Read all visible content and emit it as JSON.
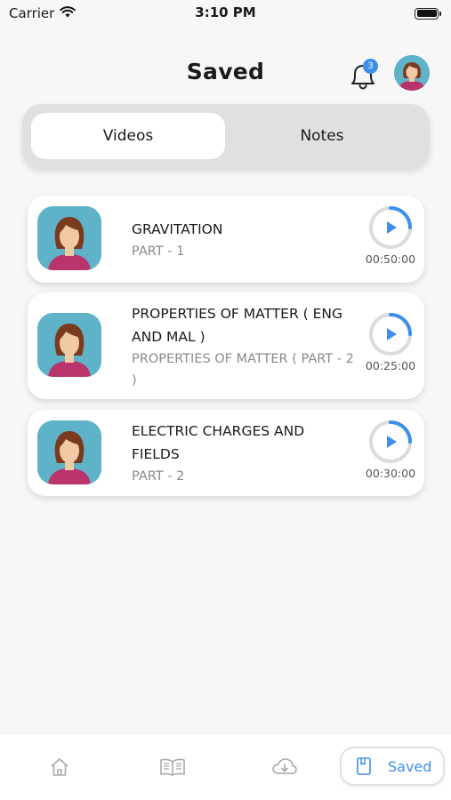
{
  "status_bar": {
    "carrier": "Carrier",
    "time": "3:10 PM"
  },
  "header": {
    "title": "Saved",
    "notification_count": "3"
  },
  "tabs": [
    {
      "label": "Videos",
      "active": true
    },
    {
      "label": "Notes",
      "active": false
    }
  ],
  "videos": [
    {
      "title": "GRAVITATION",
      "subtitle": "PART - 1",
      "duration": "00:50:00"
    },
    {
      "title": "PROPERTIES OF MATTER ( ENG AND MAL )",
      "subtitle": "PROPERTIES OF MATTER ( PART - 2 )",
      "duration": "00:25:00"
    },
    {
      "title": "ELECTRIC CHARGES AND FIELDS",
      "subtitle": "PART - 2",
      "duration": "00:30:00"
    }
  ],
  "bottom_nav": {
    "items": [
      {
        "icon": "home-icon"
      },
      {
        "icon": "book-icon"
      },
      {
        "icon": "cloud-download-icon"
      },
      {
        "icon": "bookmark-icon",
        "label": "Saved",
        "active": true
      }
    ]
  },
  "colors": {
    "accent": "#3d8fe8",
    "avatar_bg": "#5fb3c9",
    "background": "#f7f7f7"
  }
}
